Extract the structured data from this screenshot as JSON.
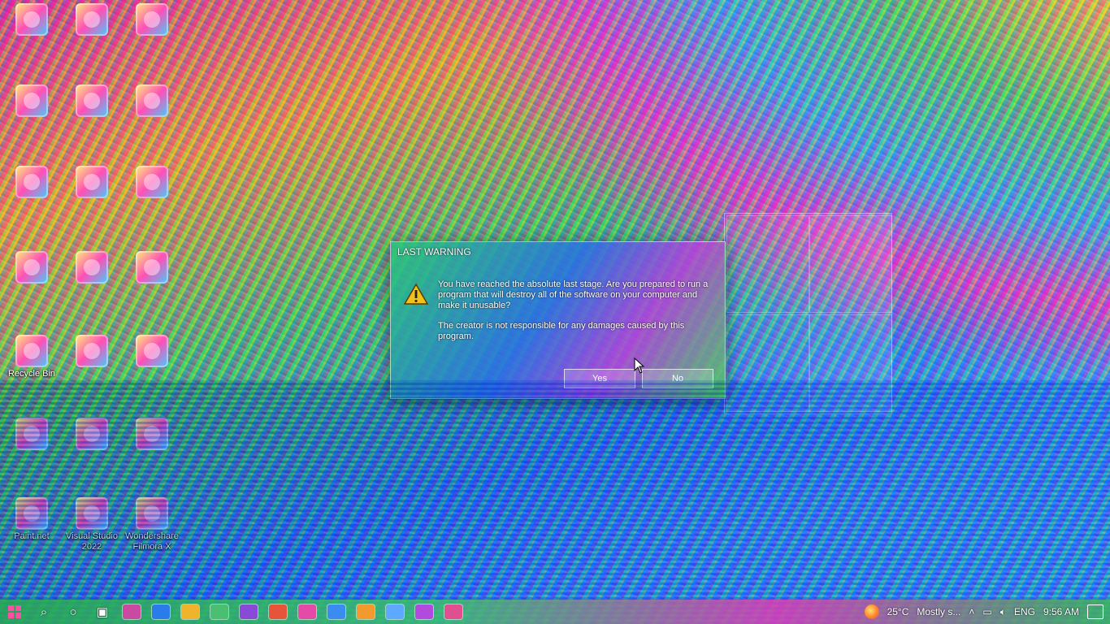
{
  "desktop": {
    "icons": [
      {
        "label": ""
      },
      {
        "label": ""
      },
      {
        "label": ""
      },
      {
        "label": ""
      },
      {
        "label": ""
      },
      {
        "label": ""
      },
      {
        "label": ""
      },
      {
        "label": ""
      },
      {
        "label": ""
      },
      {
        "label": ""
      },
      {
        "label": ""
      },
      {
        "label": ""
      },
      {
        "label": "Recycle Bin"
      },
      {
        "label": ""
      },
      {
        "label": ""
      },
      {
        "label": ""
      },
      {
        "label": ""
      },
      {
        "label": ""
      },
      {
        "label": ""
      },
      {
        "label": ""
      },
      {
        "label": ""
      },
      {
        "label": "Paint.net"
      },
      {
        "label": "Visual Studio 2022"
      },
      {
        "label": "Wondershare Filmora X"
      }
    ]
  },
  "dialog": {
    "title": "LAST WARNING",
    "message_1": "You have reached the absolute last stage. Are you prepared to run a program that will destroy all of the software on your computer and make it unusable?",
    "message_2": "The creator is not responsible for any damages caused by this program.",
    "yes_label": "Yes",
    "no_label": "No"
  },
  "taskbar": {
    "weather_temp": "25°C",
    "weather_desc": "Mostly s...",
    "language": "ENG",
    "time": "9:56 AM"
  },
  "colors": {
    "taskbar": "#3cbe6e",
    "dialog_accent": "#2f6fe0"
  }
}
